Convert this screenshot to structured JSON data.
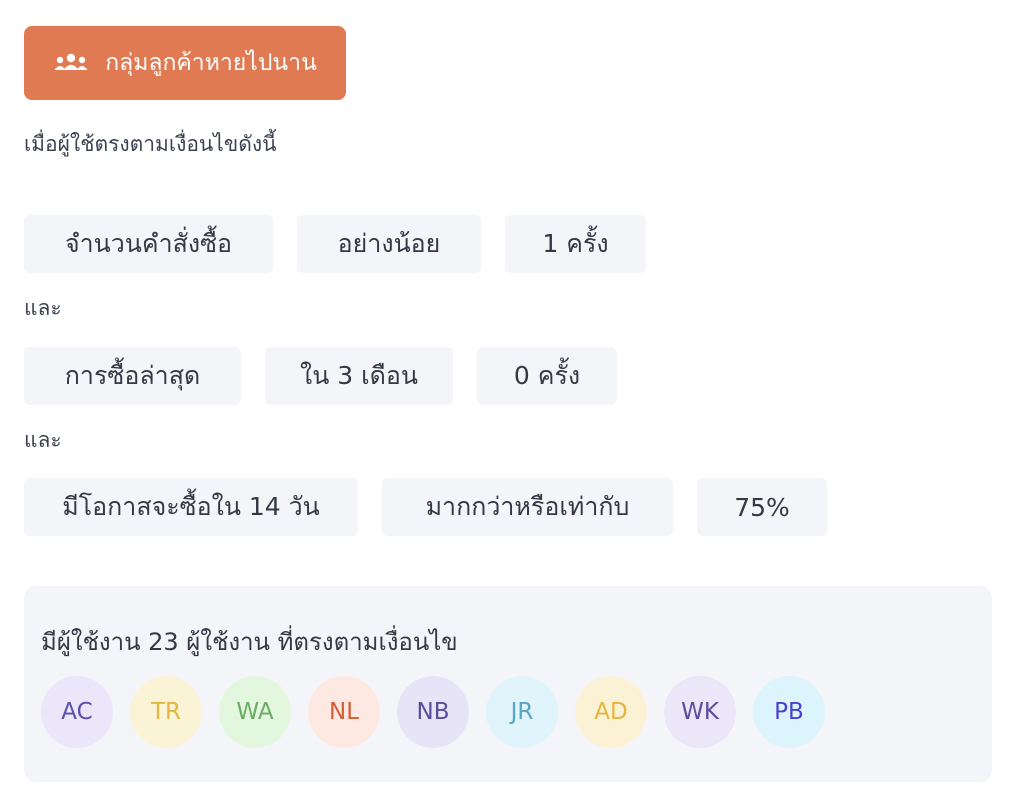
{
  "segment": {
    "label": "กลุ่มลูกค้าหายไปนาน",
    "icon": "users-icon",
    "color": "#e07a52"
  },
  "intro": "เมื่อผู้ใช้ตรงตามเงื่อนไขดังนี้",
  "connector": "และ",
  "conditions": [
    {
      "field": "จำนวนคำสั่งซื้อ",
      "operator": "อย่างน้อย",
      "value": "1 ครั้ง"
    },
    {
      "field": "การซื้อล่าสุด",
      "operator": "ใน 3 เดือน",
      "value": "0 ครั้ง"
    },
    {
      "field": "มีโอกาสจะซื้อใน 14 วัน",
      "operator": "มากกว่าหรือเท่ากับ",
      "value": "75%"
    }
  ],
  "summary": {
    "title": "มีผู้ใช้งาน 23 ผู้ใช้งาน ที่ตรงตามเงื่อนไข",
    "users": [
      {
        "initials": "AC",
        "bg": "#ece6fa",
        "fg": "#5b4fa8"
      },
      {
        "initials": "TR",
        "bg": "#fbf3d6",
        "fg": "#e1b73e"
      },
      {
        "initials": "WA",
        "bg": "#e3f7de",
        "fg": "#6cab66"
      },
      {
        "initials": "NL",
        "bg": "#fde9e1",
        "fg": "#d45d36"
      },
      {
        "initials": "NB",
        "bg": "#e8e4f8",
        "fg": "#5a4d9c"
      },
      {
        "initials": "JR",
        "bg": "#dff4fb",
        "fg": "#59a5c4"
      },
      {
        "initials": "AD",
        "bg": "#fbf2d5",
        "fg": "#e6b43e"
      },
      {
        "initials": "WK",
        "bg": "#ebe6f8",
        "fg": "#584c9b"
      },
      {
        "initials": "PB",
        "bg": "#dcf4fb",
        "fg": "#4b3fcf"
      }
    ]
  }
}
